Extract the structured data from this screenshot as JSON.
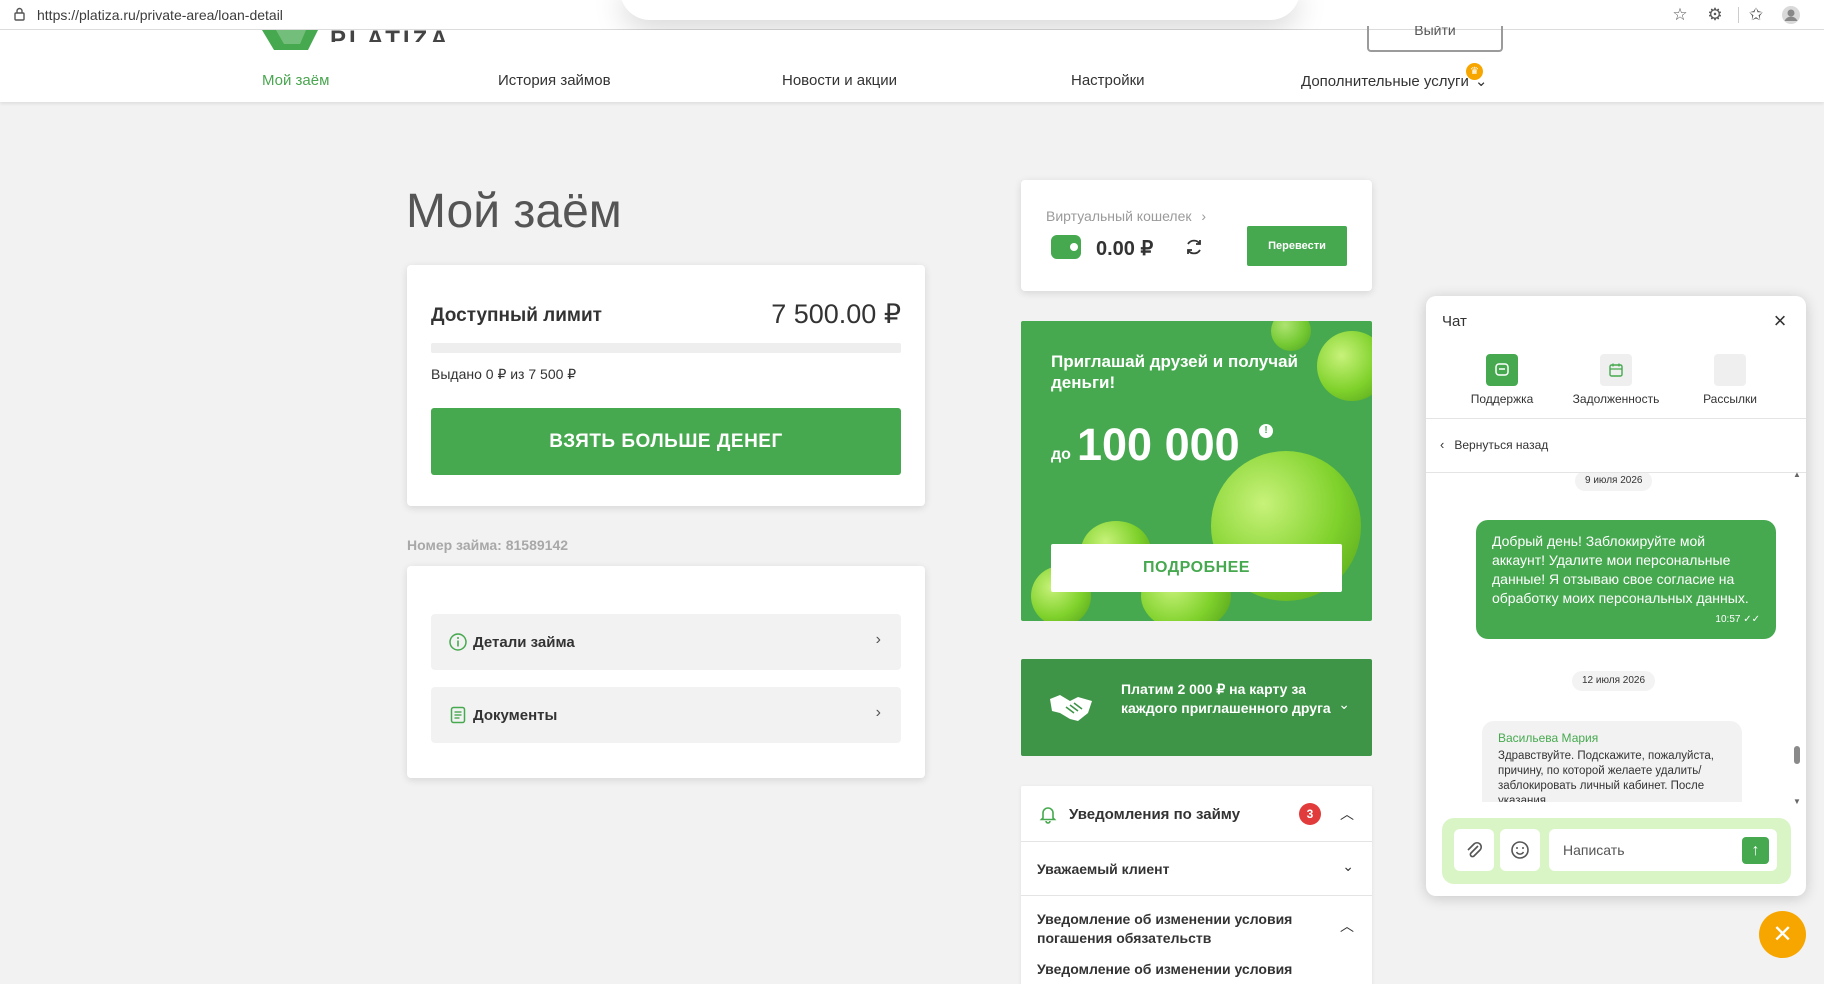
{
  "browser": {
    "url": "https://platiza.ru/private-area/loan-detail"
  },
  "header": {
    "logo_text": "PLATIZA",
    "logout_label": "Выйти",
    "nav": [
      {
        "label": "Мой заём"
      },
      {
        "label": "История займов"
      },
      {
        "label": "Новости и акции"
      },
      {
        "label": "Настройки"
      },
      {
        "label": "Дополнительные услуги"
      }
    ]
  },
  "main": {
    "title": "Мой заём",
    "limit": {
      "label": "Доступный лимит",
      "value": "7 500.00 ₽",
      "issued_text": "Выдано 0 ₽ из 7 500 ₽",
      "issued_fraction": 0,
      "button_label": "ВЗЯТЬ БОЛЬШЕ ДЕНЕГ"
    },
    "loan_number": "Номер займа: 81589142",
    "links": [
      {
        "label": "Детали займа"
      },
      {
        "label": "Документы"
      }
    ]
  },
  "sidebar": {
    "wallet": {
      "label": "Виртуальный кошелек",
      "amount": "0.00 ₽",
      "transfer_label": "Перевести"
    },
    "promo": {
      "title": "Приглашай друзей и получай деньги!",
      "prefix": "до",
      "amount": "100 000",
      "button_label": "ПОДРОБНЕЕ"
    },
    "referral": {
      "text": "Платим 2 000 ₽ на карту за каждого приглашенного друга"
    },
    "notifications": {
      "title": "Уведомления по займу",
      "count": "3",
      "items": [
        {
          "title": "Уважаемый клиент"
        },
        {
          "title": "Уведомление об изменении условия погашения обязательств"
        },
        {
          "title": "Уведомление об изменении условия"
        }
      ]
    }
  },
  "chat": {
    "title": "Чат",
    "tabs": [
      {
        "label": "Поддержка",
        "active": true
      },
      {
        "label": "Задолженность",
        "active": false
      },
      {
        "label": "Рассылки",
        "active": false
      }
    ],
    "back_label": "Вернуться назад",
    "messages": [
      {
        "date": "9 июля 2026"
      },
      {
        "text": "Добрый день! Заблокируйте мой аккаунт! Удалите мои персональные данные! Я отзываю свое согласие на обработку моих персональных данных.",
        "time": "10:57"
      },
      {
        "date": "12 июля 2026"
      },
      {
        "author": "Васильева Мария",
        "text": "Здравствуйте. Подскажите, пожалуйста, причину, по которой желаете удалить/заблокировать личный кабинет. После указания"
      }
    ],
    "input_placeholder": "Написать"
  },
  "colors": {
    "brand_green": "#46a94f",
    "accent_orange": "#f7a600",
    "badge_red": "#e23b3b"
  }
}
